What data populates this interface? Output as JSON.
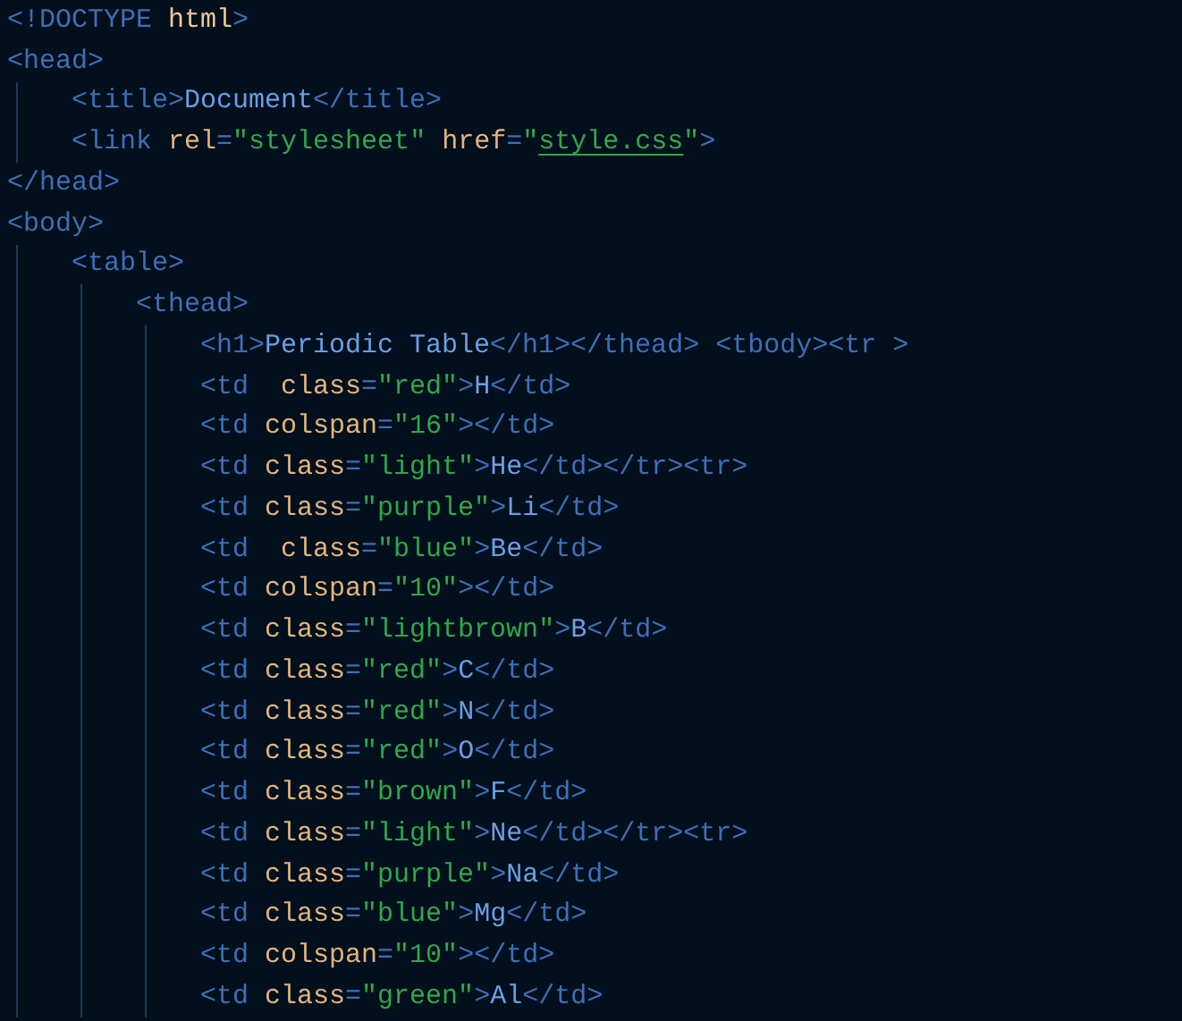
{
  "editor": {
    "lines": [
      {
        "tokens": [
          {
            "kind": "tag",
            "text": "<!DOCTYPE"
          },
          {
            "kind": "keyword",
            "text": " html"
          },
          {
            "kind": "tag",
            "text": ">"
          }
        ]
      },
      {
        "tokens": [
          {
            "kind": "tag",
            "text": "<head>"
          }
        ],
        "children": [
          {
            "tokens": [
              {
                "kind": "tag",
                "text": "<title>"
              },
              {
                "kind": "text",
                "text": "Document"
              },
              {
                "kind": "tag",
                "text": "</title>"
              }
            ]
          },
          {
            "tokens": [
              {
                "kind": "tag",
                "text": "<link "
              },
              {
                "kind": "attr",
                "text": "rel"
              },
              {
                "kind": "tag",
                "text": "="
              },
              {
                "kind": "str",
                "text": "\"stylesheet\""
              },
              {
                "kind": "attr",
                "text": " href"
              },
              {
                "kind": "tag",
                "text": "="
              },
              {
                "kind": "str",
                "text": "\""
              },
              {
                "kind": "link",
                "text": "style.css"
              },
              {
                "kind": "str",
                "text": "\""
              },
              {
                "kind": "tag",
                "text": ">"
              }
            ]
          }
        ]
      },
      {
        "tokens": [
          {
            "kind": "tag",
            "text": "</head>"
          }
        ]
      },
      {
        "tokens": [
          {
            "kind": "tag",
            "text": "<body>"
          }
        ],
        "children": [
          {
            "tokens": [
              {
                "kind": "tag",
                "text": "<table>"
              }
            ],
            "children": [
              {
                "tokens": [
                  {
                    "kind": "tag",
                    "text": "<thead>"
                  }
                ],
                "children": [
                  {
                    "tokens": [
                      {
                        "kind": "tag",
                        "text": "<h1>"
                      },
                      {
                        "kind": "text",
                        "text": "Periodic Table"
                      },
                      {
                        "kind": "tag",
                        "text": "</h1></thead> <tbody><tr >"
                      }
                    ]
                  },
                  {
                    "tokens": [
                      {
                        "kind": "tag",
                        "text": "<td  "
                      },
                      {
                        "kind": "attr",
                        "text": "class"
                      },
                      {
                        "kind": "tag",
                        "text": "="
                      },
                      {
                        "kind": "str",
                        "text": "\"red\""
                      },
                      {
                        "kind": "tag",
                        "text": ">"
                      },
                      {
                        "kind": "text",
                        "text": "H"
                      },
                      {
                        "kind": "tag",
                        "text": "</td>"
                      }
                    ]
                  },
                  {
                    "tokens": [
                      {
                        "kind": "tag",
                        "text": "<td "
                      },
                      {
                        "kind": "attr",
                        "text": "colspan"
                      },
                      {
                        "kind": "tag",
                        "text": "="
                      },
                      {
                        "kind": "str",
                        "text": "\"16\""
                      },
                      {
                        "kind": "tag",
                        "text": "></td>"
                      }
                    ]
                  },
                  {
                    "tokens": [
                      {
                        "kind": "tag",
                        "text": "<td "
                      },
                      {
                        "kind": "attr",
                        "text": "class"
                      },
                      {
                        "kind": "tag",
                        "text": "="
                      },
                      {
                        "kind": "str",
                        "text": "\"light\""
                      },
                      {
                        "kind": "tag",
                        "text": ">"
                      },
                      {
                        "kind": "text",
                        "text": "He"
                      },
                      {
                        "kind": "tag",
                        "text": "</td></tr><tr>"
                      }
                    ]
                  },
                  {
                    "tokens": [
                      {
                        "kind": "tag",
                        "text": "<td "
                      },
                      {
                        "kind": "attr",
                        "text": "class"
                      },
                      {
                        "kind": "tag",
                        "text": "="
                      },
                      {
                        "kind": "str",
                        "text": "\"purple\""
                      },
                      {
                        "kind": "tag",
                        "text": ">"
                      },
                      {
                        "kind": "text",
                        "text": "Li"
                      },
                      {
                        "kind": "tag",
                        "text": "</td>"
                      }
                    ]
                  },
                  {
                    "tokens": [
                      {
                        "kind": "tag",
                        "text": "<td  "
                      },
                      {
                        "kind": "attr",
                        "text": "class"
                      },
                      {
                        "kind": "tag",
                        "text": "="
                      },
                      {
                        "kind": "str",
                        "text": "\"blue\""
                      },
                      {
                        "kind": "tag",
                        "text": ">"
                      },
                      {
                        "kind": "text",
                        "text": "Be"
                      },
                      {
                        "kind": "tag",
                        "text": "</td>"
                      }
                    ]
                  },
                  {
                    "tokens": [
                      {
                        "kind": "tag",
                        "text": "<td "
                      },
                      {
                        "kind": "attr",
                        "text": "colspan"
                      },
                      {
                        "kind": "tag",
                        "text": "="
                      },
                      {
                        "kind": "str",
                        "text": "\"10\""
                      },
                      {
                        "kind": "tag",
                        "text": "></td>"
                      }
                    ]
                  },
                  {
                    "tokens": [
                      {
                        "kind": "tag",
                        "text": "<td "
                      },
                      {
                        "kind": "attr",
                        "text": "class"
                      },
                      {
                        "kind": "tag",
                        "text": "="
                      },
                      {
                        "kind": "str",
                        "text": "\"lightbrown\""
                      },
                      {
                        "kind": "tag",
                        "text": ">"
                      },
                      {
                        "kind": "text",
                        "text": "B"
                      },
                      {
                        "kind": "tag",
                        "text": "</td>"
                      }
                    ]
                  },
                  {
                    "tokens": [
                      {
                        "kind": "tag",
                        "text": "<td "
                      },
                      {
                        "kind": "attr",
                        "text": "class"
                      },
                      {
                        "kind": "tag",
                        "text": "="
                      },
                      {
                        "kind": "str",
                        "text": "\"red\""
                      },
                      {
                        "kind": "tag",
                        "text": ">"
                      },
                      {
                        "kind": "text",
                        "text": "C"
                      },
                      {
                        "kind": "tag",
                        "text": "</td>"
                      }
                    ]
                  },
                  {
                    "tokens": [
                      {
                        "kind": "tag",
                        "text": "<td "
                      },
                      {
                        "kind": "attr",
                        "text": "class"
                      },
                      {
                        "kind": "tag",
                        "text": "="
                      },
                      {
                        "kind": "str",
                        "text": "\"red\""
                      },
                      {
                        "kind": "tag",
                        "text": ">"
                      },
                      {
                        "kind": "text",
                        "text": "N"
                      },
                      {
                        "kind": "tag",
                        "text": "</td>"
                      }
                    ]
                  },
                  {
                    "tokens": [
                      {
                        "kind": "tag",
                        "text": "<td "
                      },
                      {
                        "kind": "attr",
                        "text": "class"
                      },
                      {
                        "kind": "tag",
                        "text": "="
                      },
                      {
                        "kind": "str",
                        "text": "\"red\""
                      },
                      {
                        "kind": "tag",
                        "text": ">"
                      },
                      {
                        "kind": "text",
                        "text": "O"
                      },
                      {
                        "kind": "tag",
                        "text": "</td>"
                      }
                    ]
                  },
                  {
                    "tokens": [
                      {
                        "kind": "tag",
                        "text": "<td "
                      },
                      {
                        "kind": "attr",
                        "text": "class"
                      },
                      {
                        "kind": "tag",
                        "text": "="
                      },
                      {
                        "kind": "str",
                        "text": "\"brown\""
                      },
                      {
                        "kind": "tag",
                        "text": ">"
                      },
                      {
                        "kind": "text",
                        "text": "F"
                      },
                      {
                        "kind": "tag",
                        "text": "</td>"
                      }
                    ]
                  },
                  {
                    "tokens": [
                      {
                        "kind": "tag",
                        "text": "<td "
                      },
                      {
                        "kind": "attr",
                        "text": "class"
                      },
                      {
                        "kind": "tag",
                        "text": "="
                      },
                      {
                        "kind": "str",
                        "text": "\"light\""
                      },
                      {
                        "kind": "tag",
                        "text": ">"
                      },
                      {
                        "kind": "text",
                        "text": "Ne"
                      },
                      {
                        "kind": "tag",
                        "text": "</td></tr><tr>"
                      }
                    ]
                  },
                  {
                    "tokens": [
                      {
                        "kind": "tag",
                        "text": "<td "
                      },
                      {
                        "kind": "attr",
                        "text": "class"
                      },
                      {
                        "kind": "tag",
                        "text": "="
                      },
                      {
                        "kind": "str",
                        "text": "\"purple\""
                      },
                      {
                        "kind": "tag",
                        "text": ">"
                      },
                      {
                        "kind": "text",
                        "text": "Na"
                      },
                      {
                        "kind": "tag",
                        "text": "</td>"
                      }
                    ]
                  },
                  {
                    "tokens": [
                      {
                        "kind": "tag",
                        "text": "<td "
                      },
                      {
                        "kind": "attr",
                        "text": "class"
                      },
                      {
                        "kind": "tag",
                        "text": "="
                      },
                      {
                        "kind": "str",
                        "text": "\"blue\""
                      },
                      {
                        "kind": "tag",
                        "text": ">"
                      },
                      {
                        "kind": "text",
                        "text": "Mg"
                      },
                      {
                        "kind": "tag",
                        "text": "</td>"
                      }
                    ]
                  },
                  {
                    "tokens": [
                      {
                        "kind": "tag",
                        "text": "<td "
                      },
                      {
                        "kind": "attr",
                        "text": "colspan"
                      },
                      {
                        "kind": "tag",
                        "text": "="
                      },
                      {
                        "kind": "str",
                        "text": "\"10\""
                      },
                      {
                        "kind": "tag",
                        "text": "></td>"
                      }
                    ]
                  },
                  {
                    "tokens": [
                      {
                        "kind": "tag",
                        "text": "<td "
                      },
                      {
                        "kind": "attr",
                        "text": "class"
                      },
                      {
                        "kind": "tag",
                        "text": "="
                      },
                      {
                        "kind": "str",
                        "text": "\"green\""
                      },
                      {
                        "kind": "tag",
                        "text": ">"
                      },
                      {
                        "kind": "text",
                        "text": "Al"
                      },
                      {
                        "kind": "tag",
                        "text": "</td>"
                      }
                    ]
                  }
                ]
              }
            ]
          }
        ]
      }
    ]
  }
}
